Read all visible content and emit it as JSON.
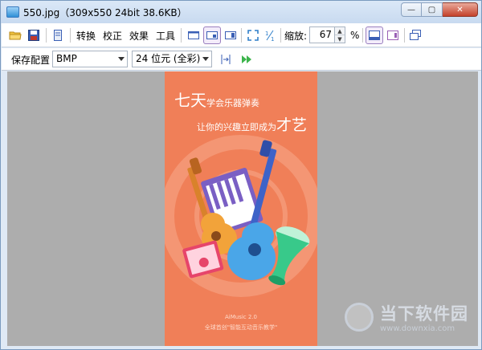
{
  "window": {
    "title": "550.jpg（309x550  24bit  38.6KB）",
    "minimize_label": "—",
    "maximize_label": "▢",
    "close_label": "✕"
  },
  "toolbar": {
    "convert_label": "转换",
    "correct_label": "校正",
    "effects_label": "效果",
    "tools_label": "工具",
    "zoom_label": "缩放:",
    "zoom_value": "67",
    "zoom_unit": "%",
    "icons": [
      "open-folder-icon",
      "save-icon",
      "page-icon",
      "fit-width-icon",
      "fit-page-icon",
      "fit-height-icon",
      "fullscreen-icon",
      "scale-icon",
      "view-mode-icon",
      "window-mode-icon",
      "restore-icon"
    ]
  },
  "save_config": {
    "label": "保存配置",
    "format_value": "BMP",
    "depth_value": "24 位元 (全彩)",
    "icons": [
      "fit-arrows-icon",
      "play-forward-icon"
    ]
  },
  "image": {
    "title_big": "七天",
    "title_small": "学会乐器弹奏",
    "sub_small": "让你的兴趣立即成为",
    "sub_big": "才艺",
    "footer_line1": "AiMusic 2.0",
    "footer_line2": "全球首创\"智能互动音乐教学\"",
    "background_color": "#f07f58"
  },
  "watermark": {
    "text": "当下软件园",
    "url": "www.downxia.com"
  }
}
